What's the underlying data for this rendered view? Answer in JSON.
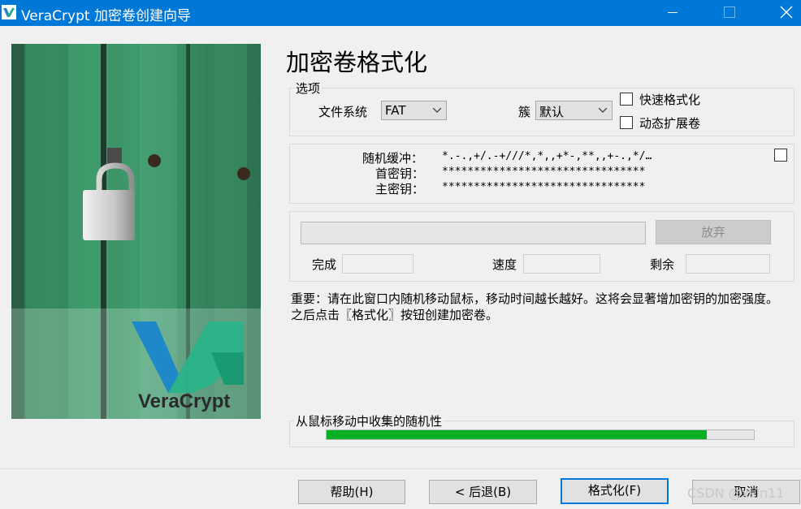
{
  "window": {
    "title": "VeraCrypt 加密卷创建向导",
    "accent_color": "#0078d7",
    "icons": [
      "veracrypt-logo-icon",
      "minimize-icon",
      "maximize-icon",
      "close-icon"
    ]
  },
  "hero": {
    "brand": "VeraCrypt",
    "icons": [
      "padlock-image",
      "veracrypt-logo"
    ]
  },
  "page": {
    "heading": "加密卷格式化"
  },
  "options": {
    "group_label": "选项",
    "filesystem_label": "文件系统",
    "filesystem_value": "FAT",
    "cluster_label": "簇",
    "cluster_value": "默认",
    "quick_format_label": "快速格式化",
    "quick_format_checked": false,
    "dynamic_label": "动态扩展卷",
    "dynamic_checked": false
  },
  "keys": {
    "random_pool_label": "随机缓冲：",
    "random_pool_value": "*.-.,+/.-+///*,*,,+*-,**,,+-.,*/…",
    "header_key_label": "首密钥：",
    "header_key_value": "********************************",
    "master_key_label": "主密钥：",
    "master_key_value": "********************************",
    "show_checked": false
  },
  "progress_group": {
    "abort_label": "放弃",
    "done_label": "完成",
    "done_value": "",
    "speed_label": "速度",
    "speed_value": "",
    "left_label": "剩余",
    "left_value": ""
  },
  "note": "重要：请在此窗口内随机移动鼠标，移动时间越长越好。这将会显著增加密钥的加密强度。之后点击〖格式化〗按钮创建加密卷。",
  "entropy": {
    "label": "从鼠标移动中收集的随机性",
    "fill_fraction": 0.89,
    "fill_color": "#06b025"
  },
  "footer": {
    "help": "帮助(H)",
    "back": "< 后退(B)",
    "format": "格式化(F)",
    "cancel": "取消"
  },
  "watermark": "CSDN @xsln11"
}
